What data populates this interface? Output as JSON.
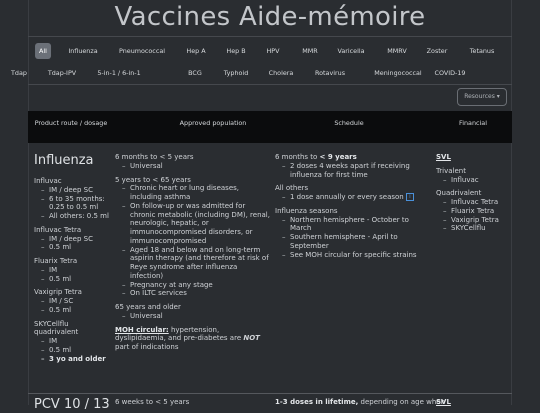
{
  "page_title": "Vaccines Aide-mémoire",
  "tabs_row1": [
    "All",
    "Influenza",
    "Pneumococcal",
    "Hep A",
    "Hep B",
    "HPV",
    "MMR",
    "Varicella",
    "MMRV",
    "Zoster",
    "Tetanus"
  ],
  "tabs_row2": [
    "Tdap",
    "Tdap-IPV",
    "5-in-1 / 6-in-1",
    "BCG",
    "Typhoid",
    "Cholera",
    "Rotavirus",
    "Meningococcal",
    "COVID-19"
  ],
  "resources_label": "Resources ▾",
  "table_headers": {
    "route": "Product route / dosage",
    "population": "Approved population",
    "schedule": "Schedule",
    "financial": "Financial"
  },
  "influenza": {
    "name": "Influenza",
    "products": [
      {
        "name": "Influvac",
        "items": [
          "IM / deep SC",
          "6 to 35 months: 0.25 to 0.5 ml",
          "All others: 0.5 ml"
        ]
      },
      {
        "name": "Influvac Tetra",
        "items": [
          "IM / deep SC",
          "0.5 ml"
        ]
      },
      {
        "name": "Fluarix Tetra",
        "items": [
          "IM",
          "0.5 ml"
        ]
      },
      {
        "name": "Vaxigrip Tetra",
        "items": [
          "IM / SC",
          "0.5 ml"
        ]
      },
      {
        "name": "SKYCellflu quadrivalent",
        "items": [
          "IM",
          "0.5 ml",
          "3 yo and older"
        ]
      }
    ],
    "population": [
      {
        "head": "6 months to < 5 years",
        "items": [
          "Universal"
        ]
      },
      {
        "head": "5 years to < 65 years",
        "items": [
          "Chronic heart or lung diseases, including asthma",
          "On follow-up or was admitted for chronic metabolic (including DM), renal, neurologic, hepatic, or immunocompromised disorders, or immunocompromised",
          "Aged 18 and below and on long-term aspirin therapy (and therefore at risk of Reye syndrome after influenza infection)",
          "Pregnancy at any stage",
          "On ILTC services"
        ]
      },
      {
        "head": "65 years and older",
        "items": [
          "Universal"
        ]
      }
    ],
    "moh_label": "MOH circular:",
    "moh_text_a": " hypertension, dyslipidaemia, and pre-diabetes are ",
    "moh_not": "NOT",
    "moh_text_b": " part of indications",
    "schedule": {
      "s1_head_a": "6 months to ",
      "s1_head_b": "< 9 years",
      "s1_items": [
        "2 doses 4 weeks apart if receiving influenza for first time"
      ],
      "s2_head": "All others",
      "s2_items": [
        "1 dose annually or every season"
      ],
      "info_icon": "i",
      "s3_head": "Influenza seasons",
      "s3_items": [
        "Northern hemisphere - October to March",
        "Southern hemisphere - April to September",
        "See MOH circular for specific strains"
      ]
    },
    "financial": {
      "svl": "SVL",
      "trivalent": "Trivalent",
      "trivalent_items": [
        "Influvac"
      ],
      "quadrivalent": "Quadrivalent",
      "quadrivalent_items": [
        "Influvac Tetra",
        "Fluarix Tetra",
        "Vaxigrip Tetra",
        "SKYCellflu"
      ]
    }
  },
  "next": {
    "name": "PCV 10 / 13",
    "population_head": "6 weeks to < 5 years",
    "schedule_b": "1-3 doses in lifetime,",
    "schedule_rest": " depending on age when",
    "financial": "SVL"
  }
}
